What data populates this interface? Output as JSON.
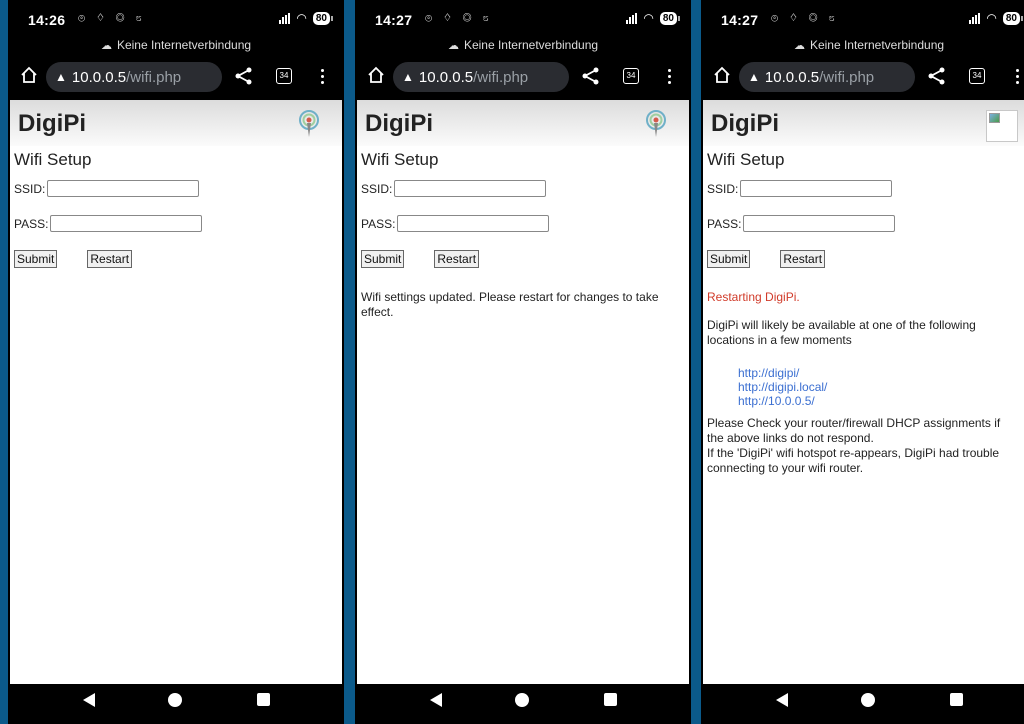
{
  "screens": [
    {
      "status": {
        "time": "14:26",
        "notifications": "⊚ ♢ ◎ ೮",
        "battery": "80"
      },
      "offline_text": "Keine Internetverbindung",
      "url": {
        "host": "10.0.0.5",
        "path": "/wifi.php"
      },
      "tabs_count": "34",
      "page": {
        "brand": "DigiPi",
        "heading": "Wifi Setup",
        "ssid_label": "SSID:",
        "pass_label": "PASS:",
        "submit": "Submit",
        "restart": "Restart"
      }
    },
    {
      "status": {
        "time": "14:27",
        "notifications": "⊚ ♢ ◎ ೮",
        "battery": "80"
      },
      "offline_text": "Keine Internetverbindung",
      "url": {
        "host": "10.0.0.5",
        "path": "/wifi.php"
      },
      "tabs_count": "34",
      "page": {
        "brand": "DigiPi",
        "heading": "Wifi Setup",
        "ssid_label": "SSID:",
        "pass_label": "PASS:",
        "submit": "Submit",
        "restart": "Restart",
        "message": "Wifi settings updated. Please restart for changes to take effect."
      }
    },
    {
      "status": {
        "time": "14:27",
        "notifications": "⊚ ♢ ◎ ೮",
        "battery": "80"
      },
      "offline_text": "Keine Internetverbindung",
      "url": {
        "host": "10.0.0.5",
        "path": "/wifi.php"
      },
      "tabs_count": "34",
      "page": {
        "brand": "DigiPi",
        "heading": "Wifi Setup",
        "ssid_label": "SSID:",
        "pass_label": "PASS:",
        "submit": "Submit",
        "restart": "Restart",
        "restarting": "Restarting DigiPi.",
        "available": "DigiPi will likely be available at one of the following locations in a few moments",
        "links": [
          "http://digipi/",
          "http://digipi.local/",
          "http://10.0.0.5/"
        ],
        "check": "Please Check your router/firewall DHCP assignments if the above links do not respond.",
        "hotspot": "If the 'DigiPi' wifi hotspot re-appears, DigiPi had trouble connecting to your wifi router."
      }
    }
  ]
}
